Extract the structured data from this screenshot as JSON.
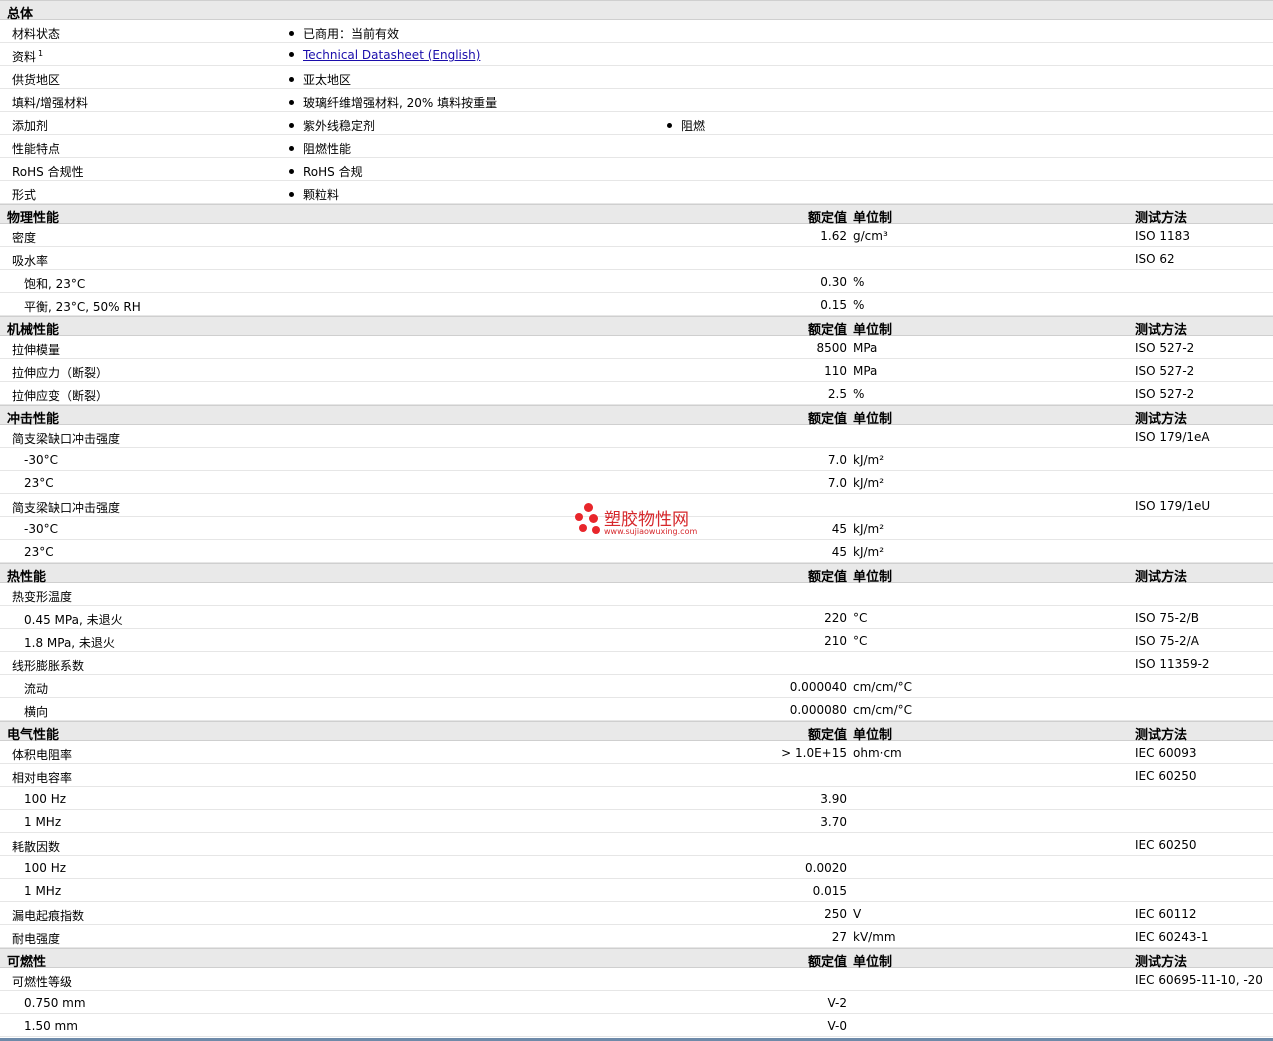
{
  "general": {
    "title": "总体",
    "rows": [
      {
        "label": "材料状态",
        "items": [
          "已商用：当前有效"
        ]
      },
      {
        "label": "资料",
        "sup": "1",
        "items": [
          "Technical Datasheet (English)"
        ],
        "link": true
      },
      {
        "label": "供货地区",
        "items": [
          "亚太地区"
        ]
      },
      {
        "label": "填料/增强材料",
        "items": [
          "玻璃纤维增强材料, 20% 填料按重量"
        ]
      },
      {
        "label": "添加剂",
        "items": [
          "紫外线稳定剂",
          "阻燃"
        ]
      },
      {
        "label": "性能特点",
        "items": [
          "阻燃性能"
        ]
      },
      {
        "label": "RoHS 合规性",
        "items": [
          "RoHS 合规"
        ]
      },
      {
        "label": "形式",
        "items": [
          "颗粒料"
        ]
      }
    ]
  },
  "headers": {
    "value": "额定值",
    "unit": "单位制",
    "test": "测试方法"
  },
  "sections": [
    {
      "title": "物理性能",
      "rows": [
        {
          "label": "密度",
          "value": "1.62",
          "unit": "g/cm³",
          "test": "ISO 1183"
        },
        {
          "label": "吸水率",
          "value": "",
          "unit": "",
          "test": "ISO 62"
        },
        {
          "label": "饱和, 23°C",
          "sub": true,
          "value": "0.30",
          "unit": "%",
          "test": ""
        },
        {
          "label": "平衡, 23°C, 50% RH",
          "sub": true,
          "value": "0.15",
          "unit": "%",
          "test": ""
        }
      ]
    },
    {
      "title": "机械性能",
      "rows": [
        {
          "label": "拉伸模量",
          "value": "8500",
          "unit": "MPa",
          "test": "ISO 527-2"
        },
        {
          "label": "拉伸应力（断裂）",
          "value": "110",
          "unit": "MPa",
          "test": "ISO 527-2"
        },
        {
          "label": "拉伸应变（断裂）",
          "value": "2.5",
          "unit": "%",
          "test": "ISO 527-2"
        }
      ]
    },
    {
      "title": "冲击性能",
      "rows": [
        {
          "label": "简支梁缺口冲击强度",
          "value": "",
          "unit": "",
          "test": "ISO 179/1eA"
        },
        {
          "label": "-30°C",
          "sub": true,
          "value": "7.0",
          "unit": "kJ/m²",
          "test": ""
        },
        {
          "label": "23°C",
          "sub": true,
          "value": "7.0",
          "unit": "kJ/m²",
          "test": ""
        },
        {
          "label": "简支梁缺口冲击强度",
          "value": "",
          "unit": "",
          "test": "ISO 179/1eU"
        },
        {
          "label": "-30°C",
          "sub": true,
          "value": "45",
          "unit": "kJ/m²",
          "test": ""
        },
        {
          "label": "23°C",
          "sub": true,
          "value": "45",
          "unit": "kJ/m²",
          "test": ""
        }
      ]
    },
    {
      "title": "热性能",
      "rows": [
        {
          "label": "热变形温度",
          "value": "",
          "unit": "",
          "test": ""
        },
        {
          "label": "0.45 MPa, 未退火",
          "sub": true,
          "value": "220",
          "unit": "°C",
          "test": "ISO 75-2/B"
        },
        {
          "label": "1.8 MPa, 未退火",
          "sub": true,
          "value": "210",
          "unit": "°C",
          "test": "ISO 75-2/A"
        },
        {
          "label": "线形膨胀系数",
          "value": "",
          "unit": "",
          "test": "ISO 11359-2"
        },
        {
          "label": "流动",
          "sub": true,
          "value": "0.000040",
          "unit": "cm/cm/°C",
          "test": ""
        },
        {
          "label": "横向",
          "sub": true,
          "value": "0.000080",
          "unit": "cm/cm/°C",
          "test": ""
        }
      ]
    },
    {
      "title": "电气性能",
      "rows": [
        {
          "label": "体积电阻率",
          "value": "> 1.0E+15",
          "unit": "ohm·cm",
          "test": "IEC 60093"
        },
        {
          "label": "相对电容率",
          "value": "",
          "unit": "",
          "test": "IEC 60250"
        },
        {
          "label": "100 Hz",
          "sub": true,
          "value": "3.90",
          "unit": "",
          "test": ""
        },
        {
          "label": "1 MHz",
          "sub": true,
          "value": "3.70",
          "unit": "",
          "test": ""
        },
        {
          "label": "耗散因数",
          "value": "",
          "unit": "",
          "test": "IEC 60250"
        },
        {
          "label": "100 Hz",
          "sub": true,
          "value": "0.0020",
          "unit": "",
          "test": ""
        },
        {
          "label": "1 MHz",
          "sub": true,
          "value": "0.015",
          "unit": "",
          "test": ""
        },
        {
          "label": "漏电起痕指数",
          "value": "250",
          "unit": "V",
          "test": "IEC 60112"
        },
        {
          "label": "耐电强度",
          "value": "27",
          "unit": "kV/mm",
          "test": "IEC 60243-1"
        }
      ]
    },
    {
      "title": "可燃性",
      "rows": [
        {
          "label": "可燃性等级",
          "value": "",
          "unit": "",
          "test": "IEC 60695-11-10, -20"
        },
        {
          "label": "0.750 mm",
          "sub": true,
          "value": "V-2",
          "unit": "",
          "test": ""
        },
        {
          "label": "1.50 mm",
          "sub": true,
          "value": "V-0",
          "unit": "",
          "test": ""
        }
      ]
    }
  ],
  "watermark": {
    "name": "塑胶物性网",
    "url": "www.sujiaowuxing.com"
  },
  "colors": {
    "section_bg": "#e9e9e9",
    "link": "#1a0dab",
    "watermark": "#d6282c"
  }
}
